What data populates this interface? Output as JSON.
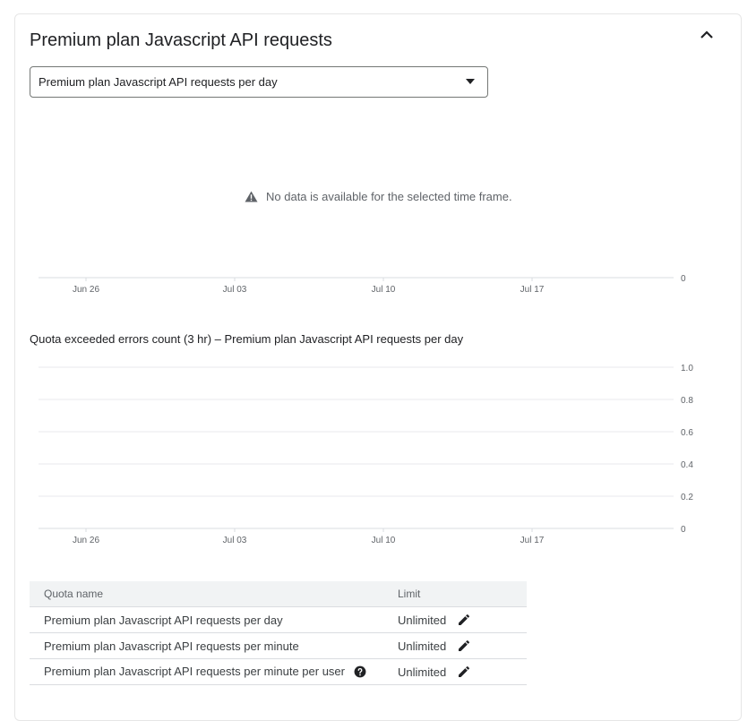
{
  "section": {
    "title": "Premium plan Javascript API requests",
    "collapse_icon": "chevron-up-icon"
  },
  "metric_select": {
    "selected": "Premium plan Javascript API requests per day"
  },
  "usage_chart": {
    "no_data_message": "No data is available for the selected time frame.",
    "no_data_icon": "warning-icon"
  },
  "errors_chart": {
    "title": "Quota exceeded errors count (3 hr) – Premium plan Javascript API requests per day"
  },
  "chart_data": [
    {
      "type": "line",
      "title": "",
      "x_ticks": [
        "Jun 26",
        "Jul 03",
        "Jul 10",
        "Jul 17"
      ],
      "y_ticks": [
        0
      ],
      "series": [],
      "grid": false,
      "y_axis_position": "right"
    },
    {
      "type": "line",
      "title": "Quota exceeded errors count (3 hr) – Premium plan Javascript API requests per day",
      "x_ticks": [
        "Jun 26",
        "Jul 03",
        "Jul 10",
        "Jul 17"
      ],
      "y_ticks": [
        0,
        0.2,
        0.4,
        0.6,
        0.8,
        1.0
      ],
      "y_tick_labels": [
        "0",
        "0.2",
        "0.4",
        "0.6",
        "0.8",
        "1.0"
      ],
      "ylim": [
        0,
        1.0
      ],
      "series": [],
      "grid": true,
      "y_axis_position": "right"
    }
  ],
  "quota_table": {
    "headers": {
      "name": "Quota name",
      "limit": "Limit"
    },
    "rows": [
      {
        "name": "Premium plan Javascript API requests per day",
        "limit": "Unlimited",
        "help": false
      },
      {
        "name": "Premium plan Javascript API requests per minute",
        "limit": "Unlimited",
        "help": false
      },
      {
        "name": "Premium plan Javascript API requests per minute per user",
        "limit": "Unlimited",
        "help": true
      }
    ],
    "edit_icon": "pencil-icon",
    "help_icon": "help-circle-icon"
  },
  "colors": {
    "grid": "#e8eaed",
    "axis": "#dadce0",
    "tick_text": "#5f6368",
    "header_bg": "#f1f3f4"
  }
}
